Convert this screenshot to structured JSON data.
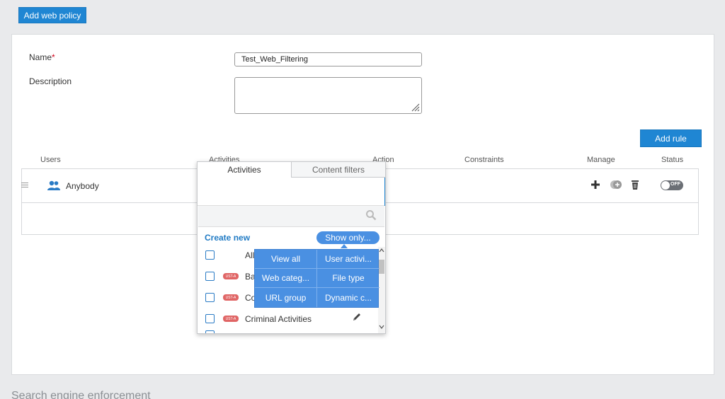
{
  "toolbar": {
    "add_policy_label": "Add web policy"
  },
  "form": {
    "name_label": "Name",
    "name_required_mark": "*",
    "name_value": "Test_Web_Filtering",
    "description_label": "Description",
    "description_value": ""
  },
  "rules": {
    "add_rule_label": "Add rule",
    "columns": [
      "Users",
      "Activities",
      "Action",
      "Constraints",
      "Manage",
      "Status"
    ],
    "row": {
      "user": "Anybody",
      "status": "OFF"
    }
  },
  "popup": {
    "tabs": [
      "Activities",
      "Content filters"
    ],
    "create_new": "Create new",
    "show_only": "Show only...",
    "items": [
      {
        "label": "All",
        "badge": ""
      },
      {
        "label": "Ba",
        "badge": "UST-A"
      },
      {
        "label": "Co",
        "badge": "UST-A"
      },
      {
        "label": "Criminal Activities",
        "badge": "UST-A"
      }
    ]
  },
  "show_only_menu": [
    "View all",
    "User activi...",
    "Web categ...",
    "File type",
    "URL group",
    "Dynamic c..."
  ],
  "section_below": "Search engine enforcement",
  "colors": {
    "primary": "#1f86d3",
    "menu": "#4a90e2",
    "badge": "#e06565"
  }
}
